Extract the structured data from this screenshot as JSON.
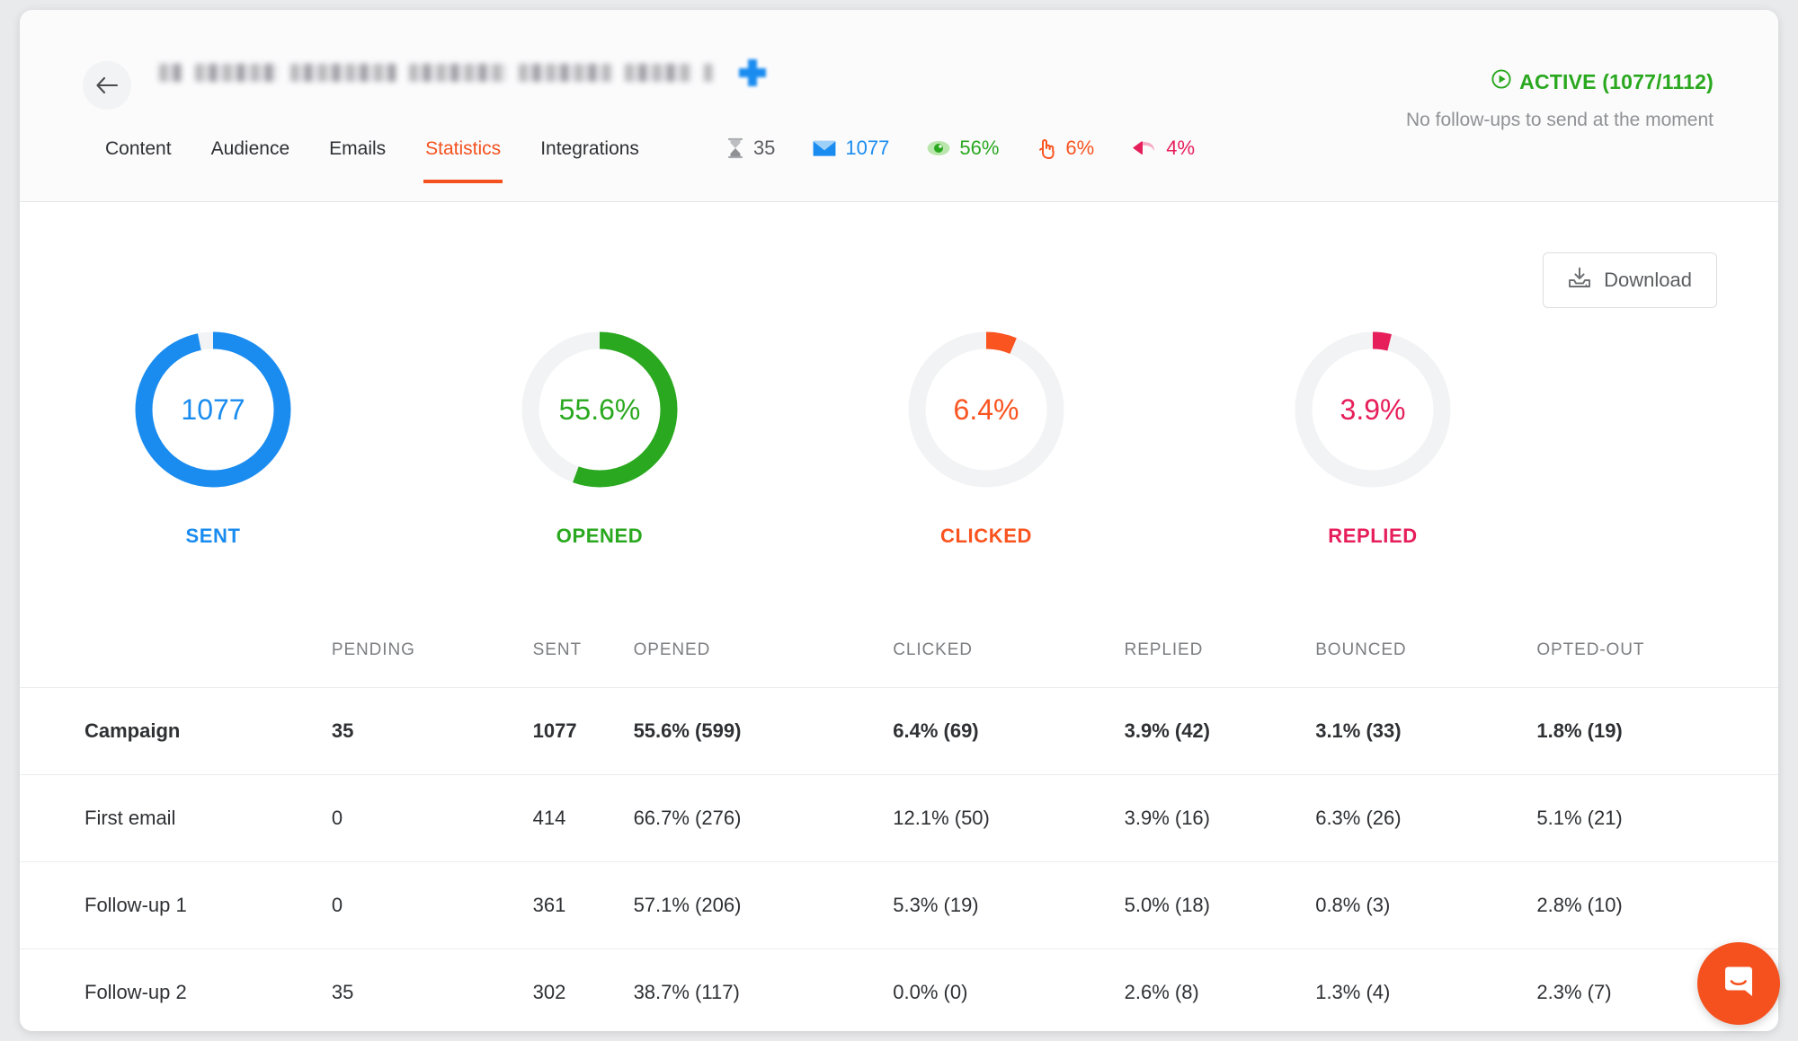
{
  "header": {
    "back_icon": "arrow-left-icon",
    "title_redacted": true,
    "status": {
      "icon": "play-circle-icon",
      "label": "ACTIVE (1077/1112)",
      "color": "#2aa81f",
      "note": "No follow-ups to send at the moment"
    }
  },
  "tabs": [
    {
      "label": "Content",
      "active": false
    },
    {
      "label": "Audience",
      "active": false
    },
    {
      "label": "Emails",
      "active": false
    },
    {
      "label": "Statistics",
      "active": true
    },
    {
      "label": "Integrations",
      "active": false
    }
  ],
  "quick_stats": [
    {
      "icon": "hourglass-icon",
      "value": "35",
      "color": "#5b5d60"
    },
    {
      "icon": "envelope-icon",
      "value": "1077",
      "color": "#1a8cf0"
    },
    {
      "icon": "eye-icon",
      "value": "56%",
      "color": "#2aa81f"
    },
    {
      "icon": "pointing-hand-icon",
      "value": "6%",
      "color": "#fa5420"
    },
    {
      "icon": "reply-arrow-icon",
      "value": "4%",
      "color": "#e61e5a"
    }
  ],
  "toolbar": {
    "download_label": "Download",
    "download_icon": "download-tray-icon"
  },
  "chart_data": {
    "type": "pie",
    "title": "Campaign statistics donuts",
    "donuts": [
      {
        "label": "SENT",
        "display": "1077",
        "percent": 96.8,
        "color": "#1a8cf0",
        "track": "#f2f3f4"
      },
      {
        "label": "OPENED",
        "display": "55.6%",
        "percent": 55.6,
        "color": "#2aa81f",
        "track": "#f2f3f4"
      },
      {
        "label": "CLICKED",
        "display": "6.4%",
        "percent": 6.4,
        "color": "#fa5420",
        "track": "#f2f3f4"
      },
      {
        "label": "REPLIED",
        "display": "3.9%",
        "percent": 3.9,
        "color": "#e61e5a",
        "track": "#f2f3f4"
      }
    ]
  },
  "table": {
    "headers": [
      "",
      "PENDING",
      "SENT",
      "OPENED",
      "CLICKED",
      "REPLIED",
      "BOUNCED",
      "OPTED-OUT"
    ],
    "rows": [
      {
        "name": "Campaign",
        "total": true,
        "pending": "35",
        "sent": "1077",
        "opened": "55.6% (599)",
        "clicked": "6.4% (69)",
        "replied": "3.9% (42)",
        "bounced": "3.1% (33)",
        "opted_out": "1.8% (19)"
      },
      {
        "name": "First email",
        "total": false,
        "pending": "0",
        "sent": "414",
        "opened": "66.7% (276)",
        "clicked": "12.1% (50)",
        "replied": "3.9% (16)",
        "bounced": "6.3% (26)",
        "opted_out": "5.1% (21)"
      },
      {
        "name": "Follow-up 1",
        "total": false,
        "pending": "0",
        "sent": "361",
        "opened": "57.1% (206)",
        "clicked": "5.3% (19)",
        "replied": "5.0% (18)",
        "bounced": "0.8% (3)",
        "opted_out": "2.8% (10)"
      },
      {
        "name": "Follow-up 2",
        "total": false,
        "pending": "35",
        "sent": "302",
        "opened": "38.7% (117)",
        "clicked": "0.0% (0)",
        "replied": "2.6% (8)",
        "bounced": "1.3% (4)",
        "opted_out": "2.3% (7)"
      }
    ]
  },
  "chat": {
    "icon": "chat-bubble-icon",
    "color": "#f4511e"
  }
}
